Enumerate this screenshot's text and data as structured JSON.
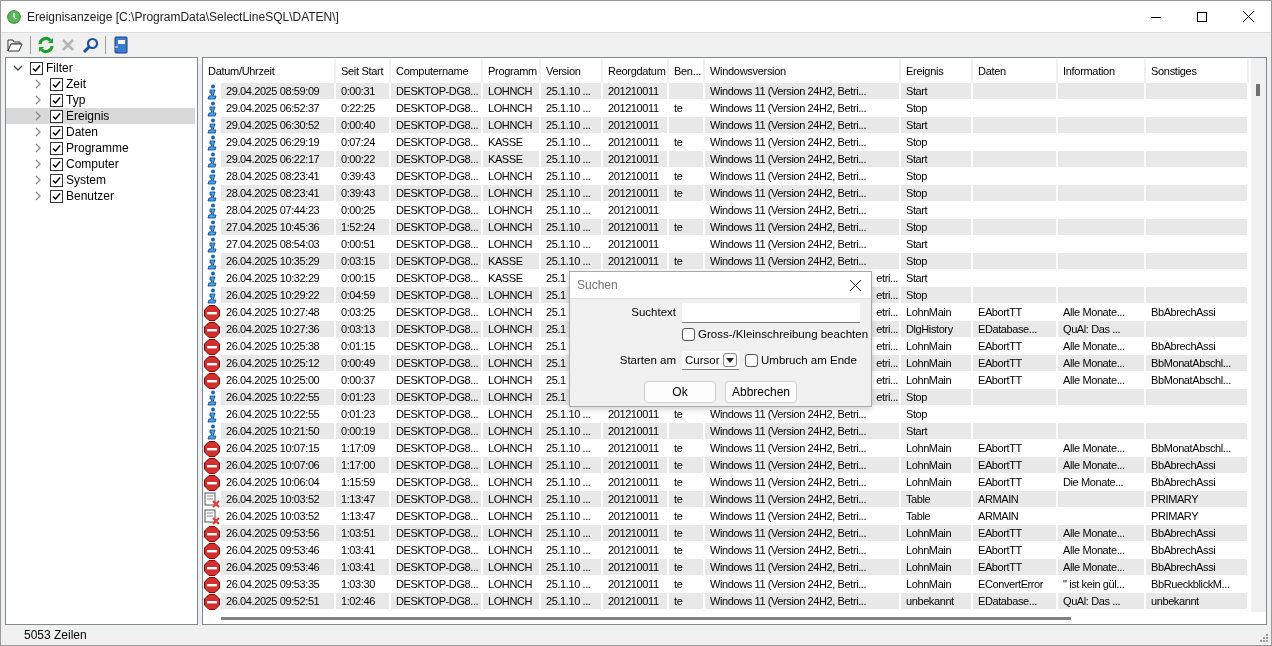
{
  "window": {
    "title": "Ereignisanzeige [C:\\ProgramData\\SelectLineSQL\\DATEN\\]"
  },
  "toolbar": [
    {
      "kind": "open",
      "disabled": false
    },
    {
      "kind": "refresh",
      "disabled": false
    },
    {
      "kind": "delete",
      "disabled": true
    },
    {
      "kind": "search",
      "disabled": false
    },
    {
      "kind": "book",
      "disabled": false
    }
  ],
  "tree": {
    "label": "Filter",
    "checked": true,
    "expanded": true,
    "selected": false,
    "children": [
      {
        "label": "Zeit",
        "checked": true,
        "expanded": false,
        "selected": false
      },
      {
        "label": "Typ",
        "checked": true,
        "expanded": false,
        "selected": false
      },
      {
        "label": "Ereignis",
        "checked": true,
        "expanded": false,
        "selected": true
      },
      {
        "label": "Daten",
        "checked": true,
        "expanded": false,
        "selected": false
      },
      {
        "label": "Programme",
        "checked": true,
        "expanded": false,
        "selected": false
      },
      {
        "label": "Computer",
        "checked": true,
        "expanded": false,
        "selected": false
      },
      {
        "label": "System",
        "checked": true,
        "expanded": false,
        "selected": false
      },
      {
        "label": "Benutzer",
        "checked": true,
        "expanded": false,
        "selected": false
      }
    ]
  },
  "table": {
    "columns": [
      "Datum/Uhrzeit",
      "Seit Start",
      "Computername",
      "Programm",
      "Version",
      "Reorgdatum",
      "Ben...",
      "Windowsversion",
      "Ereignis",
      "Daten",
      "Information",
      "Sonstiges"
    ],
    "rows": [
      {
        "kind": "info",
        "covered": false,
        "date": "29.04.2025 08:59:09",
        "uptime": "0:00:31",
        "computer": "DESKTOP-DG8...",
        "program": "LOHNCH",
        "version": "25.1.10 ...",
        "reorg": "201210011",
        "windows": "Windows 11 (Version 24H2, Betri...",
        "event": "Start"
      },
      {
        "kind": "info",
        "covered": false,
        "date": "29.04.2025 06:52:37",
        "uptime": "0:22:25",
        "computer": "DESKTOP-DG8...",
        "program": "LOHNCH",
        "version": "25.1.10 ...",
        "reorg": "201210011",
        "user": "te",
        "windows": "Windows 11 (Version 24H2, Betri...",
        "event": "Stop"
      },
      {
        "kind": "info",
        "covered": false,
        "date": "29.04.2025 06:30:52",
        "uptime": "0:00:40",
        "computer": "DESKTOP-DG8...",
        "program": "LOHNCH",
        "version": "25.1.10 ...",
        "reorg": "201210011",
        "windows": "Windows 11 (Version 24H2, Betri...",
        "event": "Start"
      },
      {
        "kind": "info",
        "covered": false,
        "date": "29.04.2025 06:29:19",
        "uptime": "0:07:24",
        "computer": "DESKTOP-DG8...",
        "program": "KASSE",
        "version": "25.1.10 ...",
        "reorg": "201210011",
        "user": "te",
        "windows": "Windows 11 (Version 24H2, Betri...",
        "event": "Stop"
      },
      {
        "kind": "info",
        "covered": false,
        "date": "29.04.2025 06:22:17",
        "uptime": "0:00:22",
        "computer": "DESKTOP-DG8...",
        "program": "KASSE",
        "version": "25.1.10 ...",
        "reorg": "201210011",
        "windows": "Windows 11 (Version 24H2, Betri...",
        "event": "Start"
      },
      {
        "kind": "info",
        "covered": false,
        "date": "28.04.2025 08:23:41",
        "uptime": "0:39:43",
        "computer": "DESKTOP-DG8...",
        "program": "LOHNCH",
        "version": "25.1.10 ...",
        "reorg": "201210011",
        "user": "te",
        "windows": "Windows 11 (Version 24H2, Betri...",
        "event": "Stop"
      },
      {
        "kind": "info",
        "covered": false,
        "date": "28.04.2025 08:23:41",
        "uptime": "0:39:43",
        "computer": "DESKTOP-DG8...",
        "program": "LOHNCH",
        "version": "25.1.10 ...",
        "reorg": "201210011",
        "user": "te",
        "windows": "Windows 11 (Version 24H2, Betri...",
        "event": "Stop"
      },
      {
        "kind": "info",
        "covered": false,
        "date": "28.04.2025 07:44:23",
        "uptime": "0:00:25",
        "computer": "DESKTOP-DG8...",
        "program": "LOHNCH",
        "version": "25.1.10 ...",
        "reorg": "201210011",
        "windows": "Windows 11 (Version 24H2, Betri...",
        "event": "Start"
      },
      {
        "kind": "info",
        "covered": false,
        "date": "27.04.2025 10:45:36",
        "uptime": "1:52:24",
        "computer": "DESKTOP-DG8...",
        "program": "LOHNCH",
        "version": "25.1.10 ...",
        "reorg": "201210011",
        "user": "te",
        "windows": "Windows 11 (Version 24H2, Betri...",
        "event": "Stop"
      },
      {
        "kind": "info",
        "covered": false,
        "date": "27.04.2025 08:54:03",
        "uptime": "0:00:51",
        "computer": "DESKTOP-DG8...",
        "program": "LOHNCH",
        "version": "25.1.10 ...",
        "reorg": "201210011",
        "windows": "Windows 11 (Version 24H2, Betri...",
        "event": "Start"
      },
      {
        "kind": "info",
        "covered": false,
        "date": "26.04.2025 10:35:29",
        "uptime": "0:03:15",
        "computer": "DESKTOP-DG8...",
        "program": "KASSE",
        "version": "25.1.10 ...",
        "reorg": "201210011",
        "user": "te",
        "windows": "Windows 11 (Version 24H2, Betri...",
        "event": "Stop"
      },
      {
        "kind": "info",
        "covered": true,
        "date": "26.04.2025 10:32:29",
        "uptime": "0:00:15",
        "computer": "DESKTOP-DG8...",
        "program": "KASSE",
        "version": "25.1",
        "windows": "etri...",
        "event": "Start"
      },
      {
        "kind": "info",
        "covered": true,
        "date": "26.04.2025 10:29:22",
        "uptime": "0:04:59",
        "computer": "DESKTOP-DG8...",
        "program": "LOHNCH",
        "version": "25.1",
        "windows": "etri...",
        "event": "Stop"
      },
      {
        "kind": "stop",
        "covered": true,
        "date": "26.04.2025 10:27:48",
        "uptime": "0:03:25",
        "computer": "DESKTOP-DG8...",
        "program": "LOHNCH",
        "version": "25.1",
        "windows": "etri...",
        "event": "LohnMain",
        "data": "EAbortTT",
        "information": "Alle Monate...",
        "other": "BbAbrechAssi"
      },
      {
        "kind": "stop",
        "covered": true,
        "date": "26.04.2025 10:27:36",
        "uptime": "0:03:13",
        "computer": "DESKTOP-DG8...",
        "program": "LOHNCH",
        "version": "25.1",
        "windows": "etri...",
        "event": "DlgHistory",
        "data": "EDatabase...",
        "information": "QuAl: Das ..."
      },
      {
        "kind": "stop",
        "covered": true,
        "date": "26.04.2025 10:25:38",
        "uptime": "0:01:15",
        "computer": "DESKTOP-DG8...",
        "program": "LOHNCH",
        "version": "25.1",
        "windows": "etri...",
        "event": "LohnMain",
        "data": "EAbortTT",
        "information": "Alle Monate...",
        "other": "BbAbrechAssi"
      },
      {
        "kind": "stop",
        "covered": true,
        "date": "26.04.2025 10:25:12",
        "uptime": "0:00:49",
        "computer": "DESKTOP-DG8...",
        "program": "LOHNCH",
        "version": "25.1",
        "windows": "etri...",
        "event": "LohnMain",
        "data": "EAbortTT",
        "information": "Alle Monate...",
        "other": "BbMonatAbschl..."
      },
      {
        "kind": "stop",
        "covered": true,
        "date": "26.04.2025 10:25:00",
        "uptime": "0:00:37",
        "computer": "DESKTOP-DG8...",
        "program": "LOHNCH",
        "version": "25.1",
        "windows": "etri...",
        "event": "LohnMain",
        "data": "EAbortTT",
        "information": "Alle Monate...",
        "other": "BbMonatAbschl..."
      },
      {
        "kind": "info",
        "covered": true,
        "date": "26.04.2025 10:22:55",
        "uptime": "0:01:23",
        "computer": "DESKTOP-DG8...",
        "program": "LOHNCH",
        "version": "25.1",
        "windows": "etri...",
        "event": "Stop"
      },
      {
        "kind": "info",
        "covered": false,
        "date": "26.04.2025 10:22:55",
        "uptime": "0:01:23",
        "computer": "DESKTOP-DG8...",
        "program": "LOHNCH",
        "version": "25.1.10 ...",
        "reorg": "201210011",
        "user": "te",
        "windows": "Windows 11 (Version 24H2, Betri...",
        "event": "Stop"
      },
      {
        "kind": "info",
        "covered": false,
        "date": "26.04.2025 10:21:50",
        "uptime": "0:00:19",
        "computer": "DESKTOP-DG8...",
        "program": "LOHNCH",
        "version": "25.1.10 ...",
        "reorg": "201210011",
        "windows": "Windows 11 (Version 24H2, Betri...",
        "event": "Start"
      },
      {
        "kind": "stop",
        "covered": false,
        "date": "26.04.2025 10:07:15",
        "uptime": "1:17:09",
        "computer": "DESKTOP-DG8...",
        "program": "LOHNCH",
        "version": "25.1.10 ...",
        "reorg": "201210011",
        "user": "te",
        "windows": "Windows 11 (Version 24H2, Betri...",
        "event": "LohnMain",
        "data": "EAbortTT",
        "information": "Alle Monate...",
        "other": "BbMonatAbschl..."
      },
      {
        "kind": "stop",
        "covered": false,
        "date": "26.04.2025 10:07:06",
        "uptime": "1:17:00",
        "computer": "DESKTOP-DG8...",
        "program": "LOHNCH",
        "version": "25.1.10 ...",
        "reorg": "201210011",
        "user": "te",
        "windows": "Windows 11 (Version 24H2, Betri...",
        "event": "LohnMain",
        "data": "EAbortTT",
        "information": "Alle Monate...",
        "other": "BbAbrechAssi"
      },
      {
        "kind": "stop",
        "covered": false,
        "date": "26.04.2025 10:06:04",
        "uptime": "1:15:59",
        "computer": "DESKTOP-DG8...",
        "program": "LOHNCH",
        "version": "25.1.10 ...",
        "reorg": "201210011",
        "user": "te",
        "windows": "Windows 11 (Version 24H2, Betri...",
        "event": "LohnMain",
        "data": "EAbortTT",
        "information": "Die Monate...",
        "other": "BbAbrechAssi"
      },
      {
        "kind": "table",
        "covered": false,
        "date": "26.04.2025 10:03:52",
        "uptime": "1:13:47",
        "computer": "DESKTOP-DG8...",
        "program": "LOHNCH",
        "version": "25.1.10 ...",
        "reorg": "201210011",
        "user": "te",
        "windows": "Windows 11 (Version 24H2, Betri...",
        "event": "Table",
        "data": "ARMAIN",
        "other": "PRIMARY"
      },
      {
        "kind": "table",
        "covered": false,
        "date": "26.04.2025 10:03:52",
        "uptime": "1:13:47",
        "computer": "DESKTOP-DG8...",
        "program": "LOHNCH",
        "version": "25.1.10 ...",
        "reorg": "201210011",
        "user": "te",
        "windows": "Windows 11 (Version 24H2, Betri...",
        "event": "Table",
        "data": "ARMAIN",
        "other": "PRIMARY"
      },
      {
        "kind": "stop",
        "covered": false,
        "date": "26.04.2025 09:53:56",
        "uptime": "1:03:51",
        "computer": "DESKTOP-DG8...",
        "program": "LOHNCH",
        "version": "25.1.10 ...",
        "reorg": "201210011",
        "user": "te",
        "windows": "Windows 11 (Version 24H2, Betri...",
        "event": "LohnMain",
        "data": "EAbortTT",
        "information": "Alle Monate...",
        "other": "BbAbrechAssi"
      },
      {
        "kind": "stop",
        "covered": false,
        "date": "26.04.2025 09:53:46",
        "uptime": "1:03:41",
        "computer": "DESKTOP-DG8...",
        "program": "LOHNCH",
        "version": "25.1.10 ...",
        "reorg": "201210011",
        "user": "te",
        "windows": "Windows 11 (Version 24H2, Betri...",
        "event": "LohnMain",
        "data": "EAbortTT",
        "information": "Alle Monate...",
        "other": "BbAbrechAssi"
      },
      {
        "kind": "stop",
        "covered": false,
        "date": "26.04.2025 09:53:46",
        "uptime": "1:03:41",
        "computer": "DESKTOP-DG8...",
        "program": "LOHNCH",
        "version": "25.1.10 ...",
        "reorg": "201210011",
        "user": "te",
        "windows": "Windows 11 (Version 24H2, Betri...",
        "event": "LohnMain",
        "data": "EAbortTT",
        "information": "Alle Monate...",
        "other": "BbAbrechAssi"
      },
      {
        "kind": "stop",
        "covered": false,
        "date": "26.04.2025 09:53:35",
        "uptime": "1:03:30",
        "computer": "DESKTOP-DG8...",
        "program": "LOHNCH",
        "version": "25.1.10 ...",
        "reorg": "201210011",
        "user": "te",
        "windows": "Windows 11 (Version 24H2, Betri...",
        "event": "LohnMain",
        "data": "EConvertError",
        "information": "\" ist kein gül...",
        "other": "BbRueckblickM..."
      },
      {
        "kind": "stop",
        "covered": false,
        "date": "26.04.2025 09:52:51",
        "uptime": "1:02:46",
        "computer": "DESKTOP-DG8...",
        "program": "LOHNCH",
        "version": "25.1.10 ...",
        "reorg": "201210011",
        "user": "te",
        "windows": "Windows 11 (Version 24H2, Betri...",
        "event": "unbekannt",
        "data": "EDatabase...",
        "information": "QuAl: Das ...",
        "other": "unbekannt"
      }
    ]
  },
  "search_dialog": {
    "title": "Suchen",
    "search_label": "Suchtext",
    "options": [
      {
        "label": "Gross-/Kleinschreibung beachten",
        "checked": false
      },
      {
        "label": "Umbruch am Ende",
        "checked": false
      }
    ],
    "start_label": "Starten am",
    "start_value": "Cursor",
    "buttons": [
      "Ok",
      "Abbrechen"
    ]
  },
  "status_bar": "5053 Zeilen"
}
